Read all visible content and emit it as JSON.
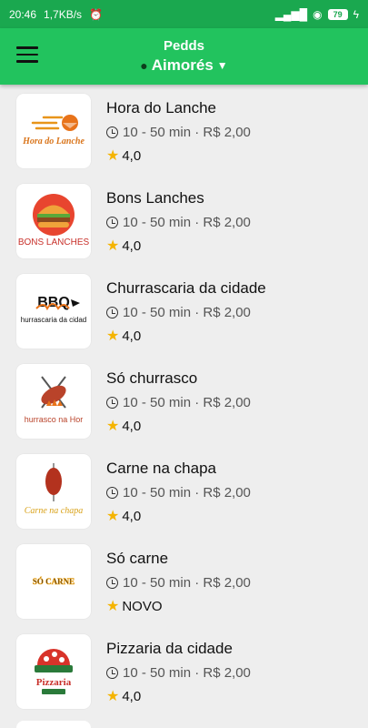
{
  "status_bar": {
    "time": "20:46",
    "network_speed": "1,7KB/s",
    "battery": "79"
  },
  "header": {
    "app_name": "Pedds",
    "city": "Aimorés"
  },
  "restaurants": [
    {
      "name": "Hora do Lanche",
      "delivery_info": "10 - 50 min · R$ 2,00",
      "rating": "4,0",
      "logo_text": "Hora do Lanche"
    },
    {
      "name": "Bons Lanches",
      "delivery_info": "10 - 50 min · R$ 2,00",
      "rating": "4,0",
      "logo_text": "BONS LANCHES"
    },
    {
      "name": "Churrascaria da cidade",
      "delivery_info": "10 - 50 min · R$ 2,00",
      "rating": "4,0",
      "logo_text": "hurrascaria da cidad"
    },
    {
      "name": "Só churrasco",
      "delivery_info": "10 - 50 min · R$ 2,00",
      "rating": "4,0",
      "logo_text": "hurrasco na Hor"
    },
    {
      "name": "Carne na chapa",
      "delivery_info": "10 - 50 min · R$ 2,00",
      "rating": "4,0",
      "logo_text": "Carne na chapa"
    },
    {
      "name": "Só carne",
      "delivery_info": "10 - 50 min · R$ 2,00",
      "rating": "NOVO",
      "logo_text": "SÓ CARNE"
    },
    {
      "name": "Pizzaria da cidade",
      "delivery_info": "10 - 50 min · R$ 2,00",
      "rating": "4,0",
      "logo_text": "Pizzaria"
    }
  ],
  "colors": {
    "status_bar": "#1aa84f",
    "app_bar": "#22c35e",
    "star": "#f5b400",
    "background": "#eeeeee"
  }
}
